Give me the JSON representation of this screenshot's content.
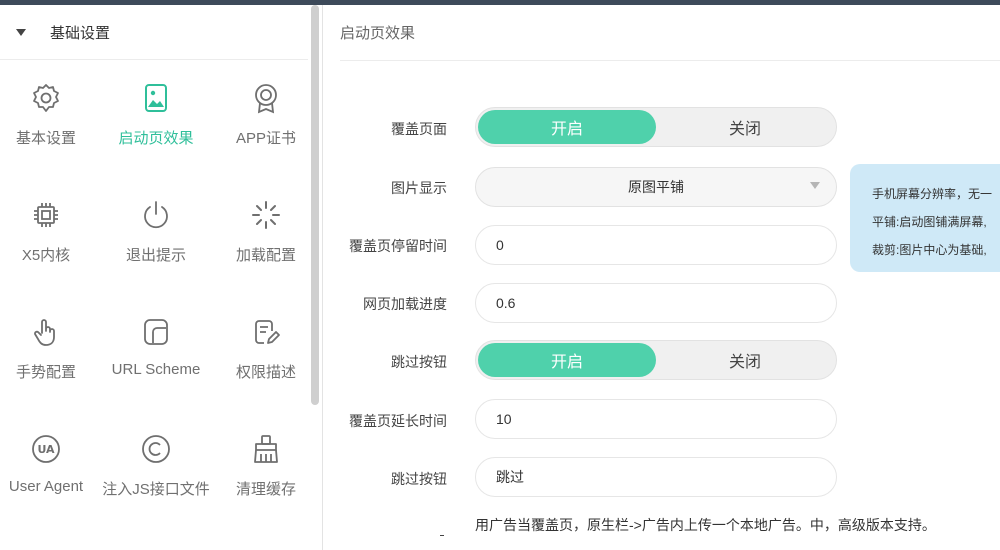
{
  "sidebar": {
    "section_title": "基础设置",
    "items": [
      {
        "label": "基本设置",
        "icon": "gear-icon"
      },
      {
        "label": "启动页效果",
        "icon": "image-icon",
        "active": true
      },
      {
        "label": "APP证书",
        "icon": "certificate-icon"
      },
      {
        "label": "X5内核",
        "icon": "chip-icon"
      },
      {
        "label": "退出提示",
        "icon": "power-icon"
      },
      {
        "label": "加载配置",
        "icon": "spinner-icon"
      },
      {
        "label": "手势配置",
        "icon": "hand-icon"
      },
      {
        "label": "URL Scheme",
        "icon": "scheme-icon"
      },
      {
        "label": "权限描述",
        "icon": "document-edit-icon"
      },
      {
        "label": "User Agent",
        "icon": "ua-icon"
      },
      {
        "label": "注入JS接口文件",
        "icon": "copyright-icon"
      },
      {
        "label": "清理缓存",
        "icon": "broom-icon"
      }
    ]
  },
  "main": {
    "title": "启动页效果",
    "form": {
      "cover_page": {
        "label": "覆盖页面",
        "on": "开启",
        "off": "关闭",
        "selected": "on"
      },
      "image_display": {
        "label": "图片显示",
        "value": "原图平铺"
      },
      "cover_duration": {
        "label": "覆盖页停留时间",
        "value": "0"
      },
      "load_progress": {
        "label": "网页加载进度",
        "value": "0.6"
      },
      "skip_button": {
        "label": "跳过按钮",
        "on": "开启",
        "off": "关闭",
        "selected": "on"
      },
      "extend_duration": {
        "label": "覆盖页延长时间",
        "value": "10"
      },
      "skip_text": {
        "label": "跳过按钮",
        "value": "跳过"
      }
    },
    "tooltip": {
      "line1": "手机屏幕分辨率，无一",
      "line2": "平铺:启动图铺满屏幕,",
      "line3": "裁剪:图片中心为基础,"
    },
    "note": "用广告当覆盖页，原生栏->广告内上传一个本地广告。中，高级版本支持。"
  },
  "colors": {
    "accent": "#4fd1ab",
    "active_text": "#2fbf9a",
    "topbar": "#3d4a5a",
    "tooltip_bg": "#cfe9f7"
  }
}
